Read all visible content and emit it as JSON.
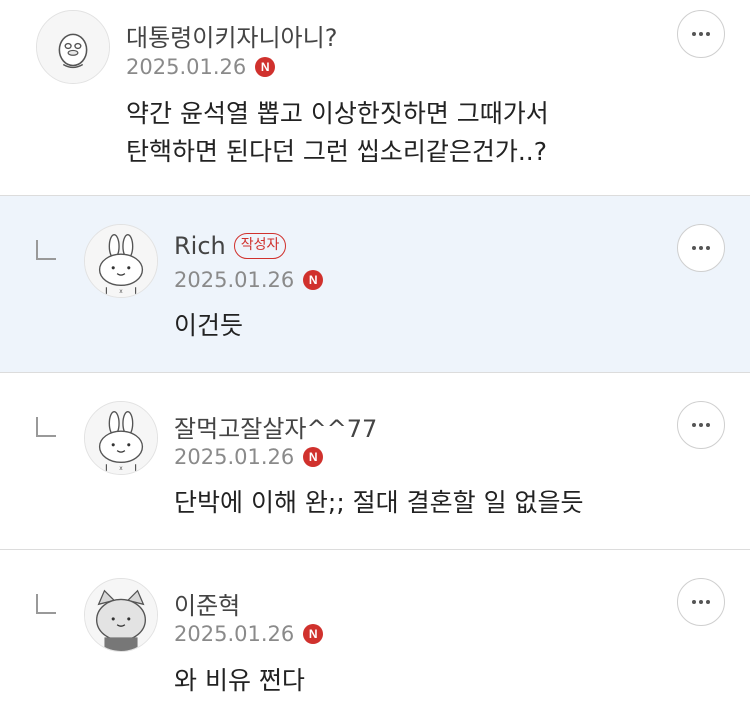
{
  "comments": [
    {
      "nickname": "대통령이키자니아니?",
      "date": "2025.01.26",
      "badge": "N",
      "text_line1": "약간 윤석열 뽑고 이상한짓하면 그때가서",
      "text_line2": "탄핵하면 된다던 그런 씹소리같은건가..?",
      "avatar": "duck-avatar-icon"
    },
    {
      "nickname": "Rich",
      "author_label": "작성자",
      "date": "2025.01.26",
      "badge": "N",
      "text": "이건듯",
      "avatar": "rabbit-avatar-icon"
    },
    {
      "nickname": "잘먹고잘살자^^77",
      "date": "2025.01.26",
      "badge": "N",
      "text": "단박에 이해 완;; 절대 결혼할 일 없을듯",
      "avatar": "rabbit-avatar-icon"
    },
    {
      "nickname": "이준혁",
      "date": "2025.01.26",
      "badge": "N",
      "text": "와 비유 쩐다",
      "avatar": "cat-avatar-icon"
    }
  ],
  "colors": {
    "highlight_bg": "#eef4fb",
    "badge_red": "#d0312d"
  }
}
